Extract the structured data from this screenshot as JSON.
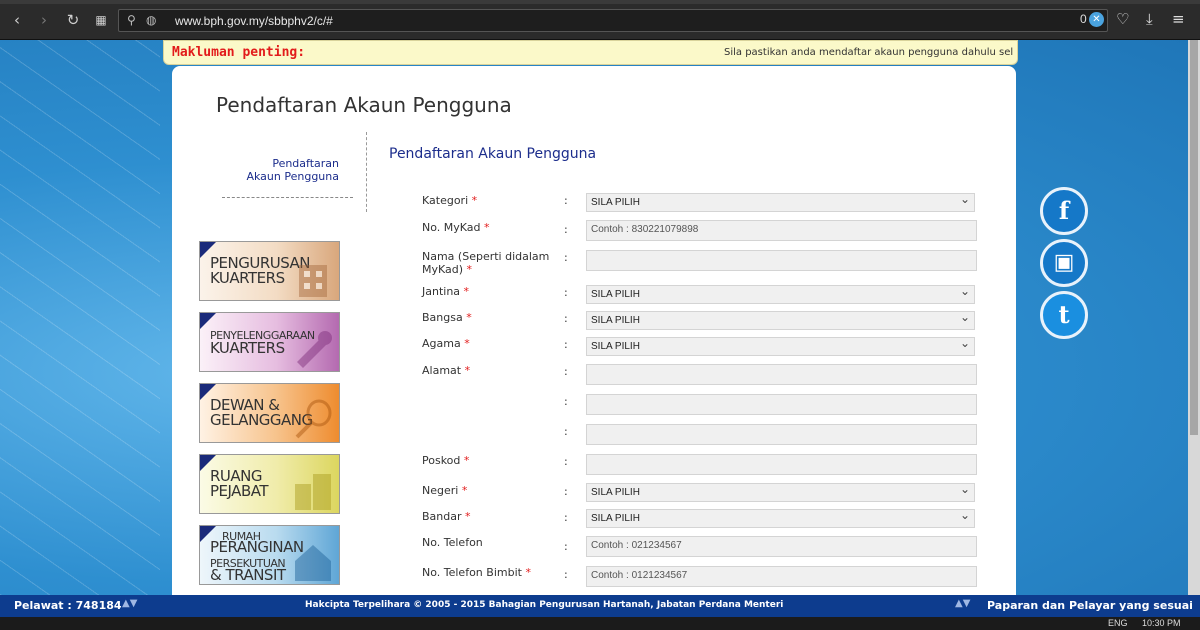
{
  "browser": {
    "url": "www.bph.gov.my/sbbphv2/c/#",
    "blocked_count": "0"
  },
  "notice": {
    "label": "Makluman penting:",
    "text": "Sila pastikan anda mendaftar akaun pengguna dahulu sel"
  },
  "page": {
    "title": "Pendaftaran Akaun Pengguna"
  },
  "sidebar": {
    "link_line1": "Pendaftaran",
    "link_line2": "Akaun Pengguna",
    "banners": [
      {
        "line1": "Pengurusan",
        "line2": "Kuarters"
      },
      {
        "line1": "Penyelenggaraan",
        "line2": "Kuarters"
      },
      {
        "line1": "Dewan &",
        "line2": "Gelanggang"
      },
      {
        "line1": "Ruang",
        "line2": "Pejabat"
      },
      {
        "line1": "Rumah",
        "line2": "Peranginan",
        "line3": "Persekutuan",
        "line4": "& Transit"
      }
    ]
  },
  "form": {
    "title": "Pendaftaran Akaun Pengguna",
    "fields": {
      "kategori": {
        "label": "Kategori",
        "value": "SILA PILIH"
      },
      "mykad": {
        "label": "No. MyKad",
        "placeholder": "Contoh : 830221079898"
      },
      "nama": {
        "label": "Nama (Seperti didalam MyKad)",
        "value": ""
      },
      "jantina": {
        "label": "Jantina",
        "value": "SILA PILIH"
      },
      "bangsa": {
        "label": "Bangsa",
        "value": "SILA PILIH"
      },
      "agama": {
        "label": "Agama",
        "value": "SILA PILIH"
      },
      "alamat": {
        "label": "Alamat",
        "value": ""
      },
      "poskod": {
        "label": "Poskod",
        "value": ""
      },
      "negeri": {
        "label": "Negeri",
        "value": "SILA PILIH"
      },
      "bandar": {
        "label": "Bandar",
        "value": "SILA PILIH"
      },
      "telefon": {
        "label": "No. Telefon",
        "placeholder": "Contoh : 021234567"
      },
      "bimbit": {
        "label": "No. Telefon Bimbit",
        "placeholder": "Contoh : 0121234567"
      }
    },
    "required_mark": "*",
    "colon": ":"
  },
  "social": {
    "facebook_glyph": "f",
    "instagram_glyph": "▣",
    "twitter_glyph": "t"
  },
  "footer": {
    "visitors": "Pelawat : 748184",
    "copyright": "Hakcipta Terpelihara © 2005 - 2015 Bahagian Pengurusan Hartanah, Jabatan Perdana Menteri",
    "browser_note": "Paparan dan Pelayar yang sesuai"
  },
  "taskbar": {
    "lang": "ENG",
    "time": "10:30 PM"
  }
}
